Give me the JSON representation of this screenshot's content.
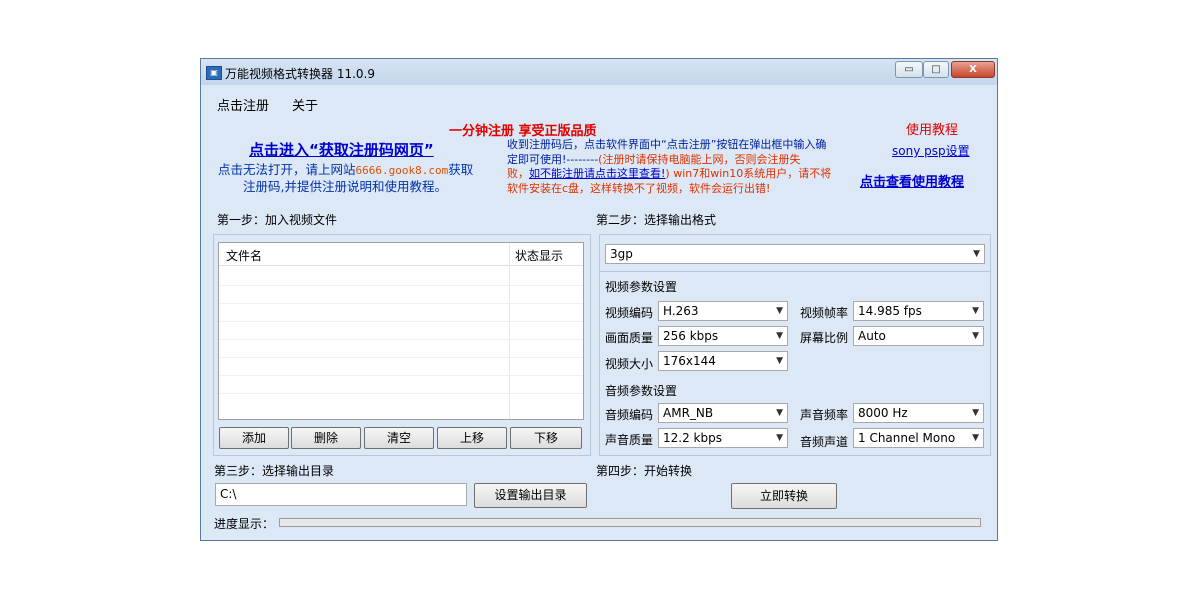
{
  "window": {
    "title": "万能视频格式转换器 11.0.9",
    "icon": "app-icon",
    "controls": {
      "minimize": "▭",
      "maximize": "□",
      "close": "X"
    }
  },
  "menu": {
    "register": "点击注册",
    "about": "关于"
  },
  "promo": {
    "headline": "一分钟注册  享受正版品质",
    "get_code_link": "点击进入“获取注册码网页”",
    "cannot_open_1": "点击无法打开，请上网站",
    "site": "6666.gook8.com",
    "cannot_open_2": "获取",
    "cannot_open_3": "注册码,并提供注册说明和使用教程。",
    "instr_1": "收到注册码后，点击软件界面中“点击注册”按钮在弹出框中输入确",
    "instr_2a": "定即可使用!--------",
    "instr_2b": "(注册时请保持电脑能上网，否则会注册失",
    "instr_3a": "败，",
    "instr_3b": "如不能注册请点击这里查看!",
    "instr_3c": ") win7和win10系统用户，请不将",
    "instr_4": "软件安装在c盘，这样转换不了视频，软件会运行出错!",
    "tutorial": "使用教程",
    "sony_psp": "sony psp设置",
    "view_tutorial": "点击查看使用教程"
  },
  "step1": {
    "label": "第一步：加入视频文件",
    "columns": [
      "文件名",
      "状态显示"
    ],
    "buttons": {
      "add": "添加",
      "delete": "删除",
      "clear": "清空",
      "up": "上移",
      "down": "下移"
    }
  },
  "step2": {
    "label": "第二步：选择输出格式",
    "format": "3gp",
    "video_section": "视频参数设置",
    "video_codec_label": "视频编码",
    "video_codec": "H.263",
    "frame_rate_label": "视频帧率",
    "frame_rate": "14.985 fps",
    "quality_label": "画面质量",
    "quality": "256 kbps",
    "aspect_label": "屏幕比例",
    "aspect": "Auto",
    "size_label": "视频大小",
    "size": "176x144",
    "audio_section": "音频参数设置",
    "audio_codec_label": "音频编码",
    "audio_codec": "AMR_NB",
    "sample_rate_label": "声音频率",
    "sample_rate": "8000 Hz",
    "audio_quality_label": "声音质量",
    "audio_quality": "12.2 kbps",
    "channels_label": "音频声道",
    "channels": "1 Channel Mono"
  },
  "step3": {
    "label": "第三步：选择输出目录",
    "path": "C:\\",
    "set_dir": "设置输出目录"
  },
  "step4": {
    "label": "第四步：开始转换",
    "convert": "立即转换"
  },
  "progress": {
    "label": "进度显示：",
    "value": 0
  }
}
